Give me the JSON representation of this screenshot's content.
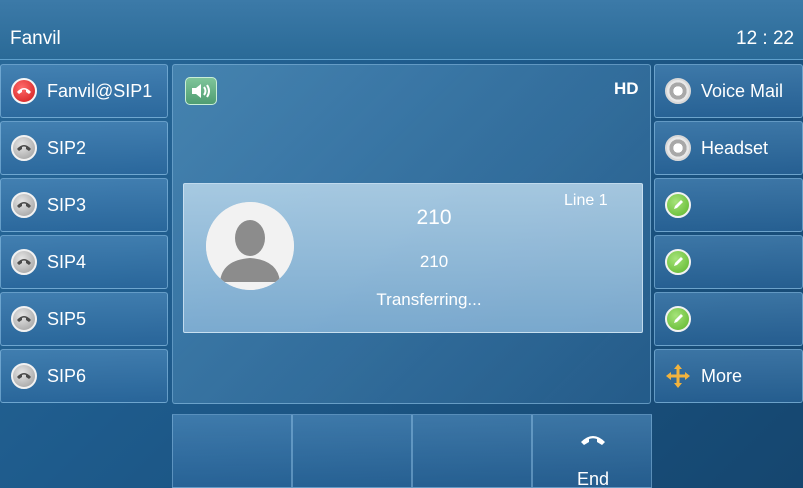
{
  "header": {
    "brand": "Fanvil",
    "time": "12 : 22"
  },
  "lines_left": [
    {
      "label": "Fanvil@SIP1",
      "icon": "phone-red-icon"
    },
    {
      "label": "SIP2",
      "icon": "phone-gray-icon"
    },
    {
      "label": "SIP3",
      "icon": "phone-gray-icon"
    },
    {
      "label": "SIP4",
      "icon": "phone-gray-icon"
    },
    {
      "label": "SIP5",
      "icon": "phone-gray-icon"
    },
    {
      "label": "SIP6",
      "icon": "phone-gray-icon"
    }
  ],
  "lines_right": [
    {
      "label": "Voice Mail",
      "icon": "radio-icon"
    },
    {
      "label": "Headset",
      "icon": "radio-icon"
    },
    {
      "label": "",
      "icon": "edit-green-icon"
    },
    {
      "label": "",
      "icon": "edit-green-icon"
    },
    {
      "label": "",
      "icon": "edit-green-icon"
    },
    {
      "label": "More",
      "icon": "move-arrows-icon"
    }
  ],
  "call": {
    "hd": "HD",
    "line": "Line 1",
    "name": "210",
    "number": "210",
    "status": "Transferring..."
  },
  "softkeys": {
    "end_label": "End"
  },
  "colors": {
    "accent": "#2a6a9a",
    "end_icon": "#ffffff",
    "active_line": "#d11a1a"
  }
}
